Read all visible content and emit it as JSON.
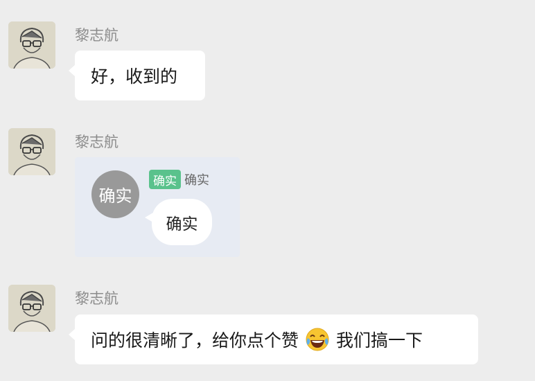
{
  "messages": [
    {
      "sender": "黎志航",
      "text": "好，收到的"
    },
    {
      "sender": "黎志航",
      "sticker": {
        "circle_text": "确实",
        "tag_text": "确实",
        "name_text": "确实",
        "bubble_text": "确实"
      }
    },
    {
      "sender": "黎志航",
      "text_before": "问的很清晰了，给你点个赞",
      "emoji": "tears-of-joy-emoji",
      "text_after": "我们搞一下"
    }
  ],
  "colors": {
    "background": "#ededed",
    "bubble": "#ffffff",
    "sender_name": "#8c8c8c",
    "tag_green": "#5ac28c"
  }
}
